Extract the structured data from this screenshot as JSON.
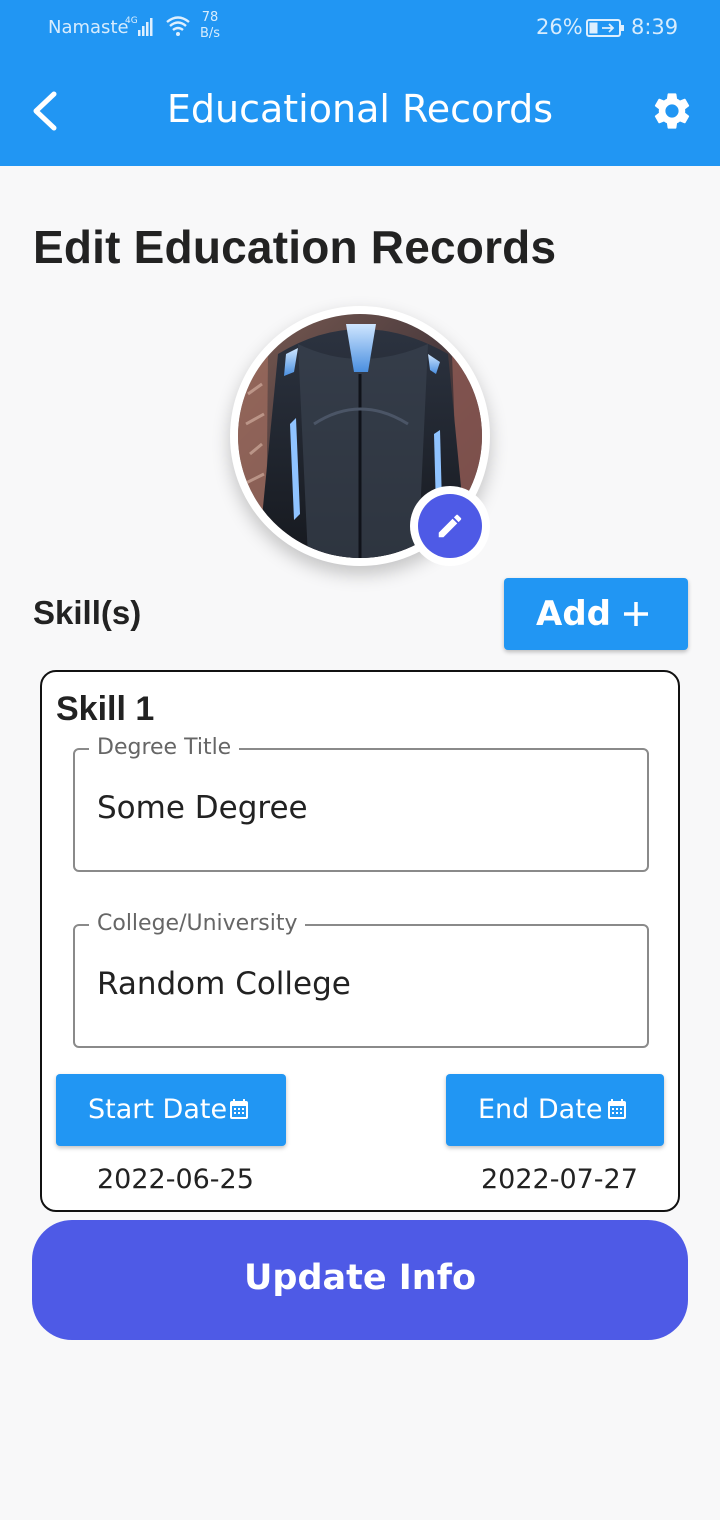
{
  "status_bar": {
    "carrier": "Namaste",
    "network_type": "4G",
    "speed_value": "78",
    "speed_unit": "B/s",
    "battery_percent": "26%",
    "time": "8:39"
  },
  "app_bar": {
    "title": "Educational Records",
    "back_icon": "chevron-left-icon",
    "settings_icon": "gear-icon"
  },
  "page": {
    "title": "Edit Education Records"
  },
  "profile": {
    "edit_icon": "pencil-icon"
  },
  "skills_section": {
    "label": "Skill(s)",
    "add_button_label": "Add",
    "add_icon": "plus-icon"
  },
  "skill_card": {
    "title": "Skill 1",
    "degree_field": {
      "label": "Degree Title",
      "value": "Some Degree"
    },
    "college_field": {
      "label": "College/University",
      "value": "Random College"
    },
    "start_date_button": "Start Date",
    "end_date_button": "End Date",
    "start_date_value": "2022-06-25",
    "end_date_value": "2022-07-27"
  },
  "update_button_label": "Update Info",
  "colors": {
    "primary": "#2196f3",
    "accent": "#4e5ae6",
    "background": "#f8f8f9",
    "text": "#222222"
  }
}
